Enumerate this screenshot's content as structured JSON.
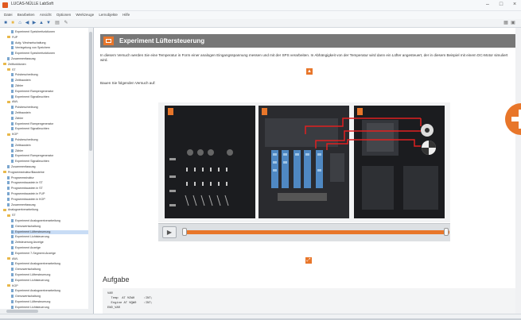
{
  "window": {
    "title": "LUCAS-NÜLLE LabSoft",
    "controls": [
      "–",
      "□",
      "×"
    ]
  },
  "menu": [
    "Datei",
    "Bearbeiten",
    "Ansicht",
    "Optionen",
    "Werkzeuge",
    "Lernobjekte",
    "Hilfe"
  ],
  "sidebar": {
    "items": [
      {
        "text": "Experiment Speicherfunktionen",
        "indent": 3,
        "kind": "page"
      },
      {
        "text": "FUP",
        "indent": 2,
        "kind": "folder"
      },
      {
        "text": "Aufg. Wechselschaltung",
        "indent": 3,
        "kind": "page"
      },
      {
        "text": "Verriegelung von Speichern",
        "indent": 3,
        "kind": "page"
      },
      {
        "text": "Experiment Speicherfunktionen",
        "indent": 3,
        "kind": "page"
      },
      {
        "text": "Zusammenfassung",
        "indent": 2,
        "kind": "page"
      },
      {
        "text": "Zeitfunktionen",
        "indent": 1,
        "kind": "folder"
      },
      {
        "text": "ST",
        "indent": 2,
        "kind": "folder"
      },
      {
        "text": "Pulsbeschreibung",
        "indent": 3,
        "kind": "page"
      },
      {
        "text": "Zeitbaustein",
        "indent": 3,
        "kind": "page"
      },
      {
        "text": "Zähler",
        "indent": 3,
        "kind": "page"
      },
      {
        "text": "Experiment Rampengenerator",
        "indent": 3,
        "kind": "page"
      },
      {
        "text": "Experiment Signalleuchten",
        "indent": 3,
        "kind": "page"
      },
      {
        "text": "AWL",
        "indent": 2,
        "kind": "folder"
      },
      {
        "text": "Pulsbeschreibung",
        "indent": 3,
        "kind": "page"
      },
      {
        "text": "Zeitbaustein",
        "indent": 3,
        "kind": "page"
      },
      {
        "text": "Zähler",
        "indent": 3,
        "kind": "page"
      },
      {
        "text": "Experiment Rampengenerator",
        "indent": 3,
        "kind": "page"
      },
      {
        "text": "Experiment Signalleuchten",
        "indent": 3,
        "kind": "page"
      },
      {
        "text": "KOP",
        "indent": 2,
        "kind": "folder"
      },
      {
        "text": "Pulsbeschreibung",
        "indent": 3,
        "kind": "page"
      },
      {
        "text": "Zeitbaustein",
        "indent": 3,
        "kind": "page"
      },
      {
        "text": "Zähler",
        "indent": 3,
        "kind": "page"
      },
      {
        "text": "Experiment Rampengenerator",
        "indent": 3,
        "kind": "page"
      },
      {
        "text": "Experiment Signalleuchten",
        "indent": 3,
        "kind": "page"
      },
      {
        "text": "Zusammenfassung",
        "indent": 2,
        "kind": "page"
      },
      {
        "text": "Programmstruktur/Bausteine",
        "indent": 1,
        "kind": "folder"
      },
      {
        "text": "Programmstruktur",
        "indent": 2,
        "kind": "page"
      },
      {
        "text": "Programmbaustein in ST",
        "indent": 2,
        "kind": "page"
      },
      {
        "text": "Programmbaustein in ST",
        "indent": 2,
        "kind": "page"
      },
      {
        "text": "Programmbaustein in FUP",
        "indent": 2,
        "kind": "page"
      },
      {
        "text": "Programmbaustein in KOP",
        "indent": 2,
        "kind": "page"
      },
      {
        "text": "Zusammenfassung",
        "indent": 2,
        "kind": "page"
      },
      {
        "text": "Analogwertverarbeitung",
        "indent": 1,
        "kind": "folder"
      },
      {
        "text": "ST",
        "indent": 2,
        "kind": "folder"
      },
      {
        "text": "Experiment Analogwertverarbeitung",
        "indent": 3,
        "kind": "page"
      },
      {
        "text": "Grenzwertschaltung",
        "indent": 3,
        "kind": "page"
      },
      {
        "text": "Experiment Lüftersteuerung",
        "indent": 3,
        "kind": "page",
        "selected": true
      },
      {
        "text": "Experiment Lichtsteuerung",
        "indent": 3,
        "kind": "page"
      },
      {
        "text": "Zeitsteuerung Anzeige",
        "indent": 3,
        "kind": "page"
      },
      {
        "text": "Experiment Anzeige",
        "indent": 3,
        "kind": "page"
      },
      {
        "text": "Experiment 7-Segment-Anzeige",
        "indent": 3,
        "kind": "page"
      },
      {
        "text": "AWL",
        "indent": 2,
        "kind": "folder"
      },
      {
        "text": "Experiment Analogwertverarbeitung",
        "indent": 3,
        "kind": "page"
      },
      {
        "text": "Grenzwertschaltung",
        "indent": 3,
        "kind": "page"
      },
      {
        "text": "Experiment Lüftersteuerung",
        "indent": 3,
        "kind": "page"
      },
      {
        "text": "Experiment Lichtsteuerung",
        "indent": 3,
        "kind": "page"
      },
      {
        "text": "KOP",
        "indent": 2,
        "kind": "folder"
      },
      {
        "text": "Experiment Analogwertverarbeitung",
        "indent": 3,
        "kind": "page"
      },
      {
        "text": "Grenzwertschaltung",
        "indent": 3,
        "kind": "page"
      },
      {
        "text": "Experiment Lüftersteuerung",
        "indent": 3,
        "kind": "page"
      },
      {
        "text": "Experiment Lichtsteuerung",
        "indent": 3,
        "kind": "page"
      },
      {
        "text": "Zusammenfassung",
        "indent": 2,
        "kind": "page"
      }
    ]
  },
  "content": {
    "header_title": "Experiment Lüftersteuerung",
    "intro": "In diesem Versuch werden Sie eine Temperatur in Form einer analogen Eingangsspannung messen und mit der SPS verarbeiten. In Abhängigkeit von der Temperatur wird dann ein Lüfter angesteuert, der in diesem Beispiel mit einem DC-Motor simuliert wird.",
    "lead": "Bauen Sie folgenden Versuch auf:",
    "collapse_icon": "▲",
    "play_icon": "▶",
    "aufgabe_heading": "Aufgabe",
    "code": "VAR\n  Temp  AT %IW0     :INT;\n  Engine AT %QW0    :INT;\nEND_VAR",
    "accent": "#e8762a"
  }
}
